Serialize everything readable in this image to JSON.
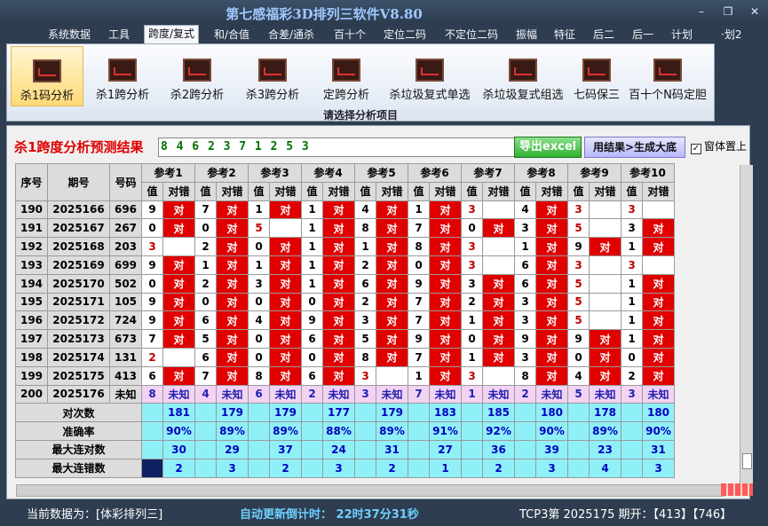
{
  "window": {
    "title": "第七感福彩3D排列三软件V8.80",
    "min": "–",
    "restore": "❐",
    "close": "✕"
  },
  "menu": [
    "系统数据",
    "工具",
    "跨度/复式",
    "和/合值",
    "合差/通杀",
    "百十个",
    "定位二码",
    "不定位二码",
    "振幅",
    "特征",
    "后二",
    "后一",
    "计划",
    "·划2"
  ],
  "menu_active": 2,
  "ribbon": {
    "buttons": [
      "杀1码分析",
      "杀1跨分析",
      "杀2跨分析",
      "杀3跨分析",
      "定跨分析",
      "杀垃圾复式单选",
      "杀垃圾复式组选",
      "七码保三",
      "百十个N码定胆"
    ],
    "selected": 0,
    "caption": "请选择分析项目"
  },
  "result": {
    "title": "杀1跨度分析预测结果",
    "value": "8 4 6 2 3 7 1 2 5 3",
    "export_button": "导出excel",
    "gen_button": "用结果>生成大底",
    "topmost_checkbox": "窗体置上",
    "topmost_checked": true
  },
  "table": {
    "headers": {
      "index": "序号",
      "period": "期号",
      "number": "号码",
      "value": "值",
      "result": "对错"
    },
    "refs": [
      "参考1",
      "参考2",
      "参考3",
      "参考4",
      "参考5",
      "参考6",
      "参考7",
      "参考8",
      "参考9",
      "参考10"
    ],
    "rows": [
      {
        "idx": "190",
        "period": "2025166",
        "num": "696",
        "cells": [
          [
            "9",
            "对"
          ],
          [
            "7",
            "对"
          ],
          [
            "1",
            "对"
          ],
          [
            "1",
            "对"
          ],
          [
            "4",
            "对"
          ],
          [
            "1",
            "对"
          ],
          [
            "3",
            ""
          ],
          [
            "4",
            "对"
          ],
          [
            "3",
            ""
          ],
          [
            "3",
            ""
          ]
        ]
      },
      {
        "idx": "191",
        "period": "2025167",
        "num": "267",
        "cells": [
          [
            "0",
            "对"
          ],
          [
            "0",
            "对"
          ],
          [
            "5",
            ""
          ],
          [
            "1",
            "对"
          ],
          [
            "8",
            "对"
          ],
          [
            "7",
            "对"
          ],
          [
            "0",
            "对"
          ],
          [
            "3",
            "对"
          ],
          [
            "5",
            ""
          ],
          [
            "3",
            "对"
          ]
        ]
      },
      {
        "idx": "192",
        "period": "2025168",
        "num": "203",
        "cells": [
          [
            "3",
            ""
          ],
          [
            "2",
            "对"
          ],
          [
            "0",
            "对"
          ],
          [
            "1",
            "对"
          ],
          [
            "1",
            "对"
          ],
          [
            "8",
            "对"
          ],
          [
            "3",
            ""
          ],
          [
            "1",
            "对"
          ],
          [
            "9",
            "对"
          ],
          [
            "1",
            "对"
          ]
        ]
      },
      {
        "idx": "193",
        "period": "2025169",
        "num": "699",
        "cells": [
          [
            "9",
            "对"
          ],
          [
            "1",
            "对"
          ],
          [
            "1",
            "对"
          ],
          [
            "1",
            "对"
          ],
          [
            "2",
            "对"
          ],
          [
            "0",
            "对"
          ],
          [
            "3",
            ""
          ],
          [
            "6",
            "对"
          ],
          [
            "3",
            ""
          ],
          [
            "3",
            ""
          ]
        ]
      },
      {
        "idx": "194",
        "period": "2025170",
        "num": "502",
        "cells": [
          [
            "0",
            "对"
          ],
          [
            "2",
            "对"
          ],
          [
            "3",
            "对"
          ],
          [
            "1",
            "对"
          ],
          [
            "6",
            "对"
          ],
          [
            "9",
            "对"
          ],
          [
            "3",
            "对"
          ],
          [
            "6",
            "对"
          ],
          [
            "5",
            ""
          ],
          [
            "1",
            "对"
          ]
        ]
      },
      {
        "idx": "195",
        "period": "2025171",
        "num": "105",
        "cells": [
          [
            "9",
            "对"
          ],
          [
            "0",
            "对"
          ],
          [
            "0",
            "对"
          ],
          [
            "0",
            "对"
          ],
          [
            "2",
            "对"
          ],
          [
            "7",
            "对"
          ],
          [
            "2",
            "对"
          ],
          [
            "3",
            "对"
          ],
          [
            "5",
            ""
          ],
          [
            "1",
            "对"
          ]
        ]
      },
      {
        "idx": "196",
        "period": "2025172",
        "num": "724",
        "cells": [
          [
            "9",
            "对"
          ],
          [
            "6",
            "对"
          ],
          [
            "4",
            "对"
          ],
          [
            "9",
            "对"
          ],
          [
            "3",
            "对"
          ],
          [
            "7",
            "对"
          ],
          [
            "1",
            "对"
          ],
          [
            "3",
            "对"
          ],
          [
            "5",
            ""
          ],
          [
            "1",
            "对"
          ]
        ]
      },
      {
        "idx": "197",
        "period": "2025173",
        "num": "673",
        "cells": [
          [
            "7",
            "对"
          ],
          [
            "5",
            "对"
          ],
          [
            "0",
            "对"
          ],
          [
            "6",
            "对"
          ],
          [
            "5",
            "对"
          ],
          [
            "9",
            "对"
          ],
          [
            "0",
            "对"
          ],
          [
            "9",
            "对"
          ],
          [
            "9",
            "对"
          ],
          [
            "1",
            "对"
          ]
        ]
      },
      {
        "idx": "198",
        "period": "2025174",
        "num": "131",
        "cells": [
          [
            "2",
            ""
          ],
          [
            "6",
            "对"
          ],
          [
            "0",
            "对"
          ],
          [
            "0",
            "对"
          ],
          [
            "8",
            "对"
          ],
          [
            "7",
            "对"
          ],
          [
            "1",
            "对"
          ],
          [
            "3",
            "对"
          ],
          [
            "0",
            "对"
          ],
          [
            "0",
            "对"
          ]
        ]
      },
      {
        "idx": "199",
        "period": "2025175",
        "num": "413",
        "cells": [
          [
            "6",
            "对"
          ],
          [
            "7",
            "对"
          ],
          [
            "8",
            "对"
          ],
          [
            "6",
            "对"
          ],
          [
            "3",
            ""
          ],
          [
            "1",
            "对"
          ],
          [
            "3",
            ""
          ],
          [
            "8",
            "对"
          ],
          [
            "4",
            "对"
          ],
          [
            "2",
            "对"
          ]
        ]
      }
    ],
    "future": {
      "idx": "200",
      "period": "2025176",
      "num": "未知",
      "values": [
        "8",
        "4",
        "6",
        "2",
        "3",
        "7",
        "1",
        "2",
        "5",
        "3"
      ],
      "unknown": "未知"
    },
    "stats": [
      {
        "label": "对次数",
        "values": [
          "181",
          "179",
          "179",
          "177",
          "179",
          "183",
          "185",
          "180",
          "178",
          "180"
        ]
      },
      {
        "label": "准确率",
        "values": [
          "90%",
          "89%",
          "89%",
          "88%",
          "89%",
          "91%",
          "92%",
          "90%",
          "89%",
          "90%"
        ]
      },
      {
        "label": "最大连对数",
        "values": [
          "30",
          "29",
          "37",
          "24",
          "31",
          "27",
          "36",
          "39",
          "23",
          "31"
        ]
      },
      {
        "label": "最大连错数",
        "values": [
          "2",
          "3",
          "2",
          "3",
          "2",
          "1",
          "2",
          "3",
          "4",
          "3"
        ]
      }
    ]
  },
  "status": {
    "current_label": "当前数据为：[体彩排列三]",
    "countdown": "自动更新倒计时：   22时37分31秒",
    "period": "TCP3第  2025175  期开：【413】【746】"
  },
  "colors": {
    "hit": "#e00000",
    "title": "#e00000",
    "stats_bg": "#8ff0f8",
    "future_bg": "#f3d3f3"
  }
}
